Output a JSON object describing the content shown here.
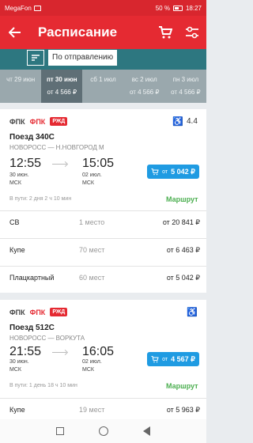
{
  "status_bar": {
    "carrier": "MegaFon",
    "battery": "50 %",
    "time": "18:27"
  },
  "header": {
    "title": "Расписание",
    "back_icon": "arrow-left-icon",
    "cart_icon": "cart-icon",
    "filter_icon": "sliders-icon"
  },
  "sort": {
    "label": "По отправлению"
  },
  "dates": [
    {
      "day": "чт 29 июн",
      "price": ""
    },
    {
      "day": "пт 30 июн",
      "price": "от 4 566 ₽",
      "active": true
    },
    {
      "day": "сб 1 июл",
      "price": ""
    },
    {
      "day": "вс 2 июл",
      "price": "от 4 566 ₽"
    },
    {
      "day": "пн 3 июл",
      "price": "от 4 566 ₽"
    }
  ],
  "trains": [
    {
      "carrier1": "ФПК",
      "carrier2": "ФПК",
      "brand": "РЖД",
      "rating": "4.4",
      "name": "Поезд 340С",
      "route": "НОВОРОСС — Н.НОВГОРОД М",
      "dep_time": "12:55",
      "dep_date": "30 июн.",
      "dep_tz": "МСК",
      "arr_time": "15:05",
      "arr_date": "02 июл.",
      "arr_tz": "МСК",
      "price_from": "от",
      "price": "5 042 ₽",
      "travel_time": "В пути: 2 дня 2 ч 10 мин",
      "route_link": "Маршрут",
      "classes": [
        {
          "name": "СВ",
          "seats": "1 место",
          "price": "от 20 841 ₽"
        },
        {
          "name": "Купе",
          "seats": "70 мест",
          "price": "от 6 463 ₽"
        },
        {
          "name": "Плацкартный",
          "seats": "60 мест",
          "price": "от 5 042 ₽"
        }
      ]
    },
    {
      "carrier1": "ФПК",
      "carrier2": "ФПК",
      "brand": "РЖД",
      "name": "Поезд 512С",
      "route": "НОВОРОСС — ВОРКУТА",
      "dep_time": "21:55",
      "dep_date": "30 июн.",
      "dep_tz": "МСК",
      "arr_time": "16:05",
      "arr_date": "02 июл.",
      "arr_tz": "МСК",
      "price_from": "от",
      "price": "4 567 ₽",
      "travel_time": "В пути: 1 день 18 ч 10 мин",
      "route_link": "Маршрут",
      "classes": [
        {
          "name": "Купе",
          "seats": "19 мест",
          "price": "от 5 963 ₽"
        }
      ]
    }
  ],
  "colors": {
    "brand_red": "#e52a32",
    "teal": "#2d7780",
    "price_blue": "#1f9be2",
    "route_green": "#4caf50"
  }
}
